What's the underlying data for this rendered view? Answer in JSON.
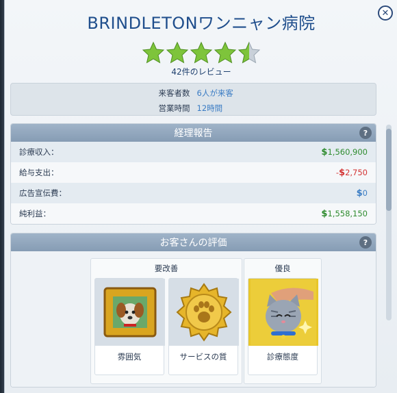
{
  "header": {
    "title": "BRINDLETONワンニャン病院",
    "rating": 4.5,
    "review_count": "42件のレビュー",
    "close_label": "✕"
  },
  "info": {
    "visitors_label": "来客者数",
    "visitors_value": "6人が来客",
    "hours_label": "営業時間",
    "hours_value": "12時間"
  },
  "finance": {
    "title": "経理報告",
    "help": "?",
    "rows": [
      {
        "label": "診療収入：",
        "sign": "",
        "amount": "1,560,900",
        "type": "pos"
      },
      {
        "label": "給与支出：",
        "sign": "-",
        "amount": "2,750",
        "type": "neg"
      },
      {
        "label": "広告宣伝費：",
        "sign": "",
        "amount": "0",
        "type": "zero"
      },
      {
        "label": "純利益：",
        "sign": "",
        "amount": "1,558,150",
        "type": "pos"
      }
    ],
    "currency_symbol": "$"
  },
  "evaluation": {
    "title": "お客さんの評価",
    "help": "?",
    "needs_improvement": {
      "title": "要改善",
      "items": [
        {
          "label": "雰囲気",
          "icon": "dog-portrait-icon"
        },
        {
          "label": "サービスの質",
          "icon": "gold-paw-medal-icon"
        }
      ]
    },
    "excellent": {
      "title": "優良",
      "items": [
        {
          "label": "診療態度",
          "icon": "petting-cat-icon"
        }
      ]
    }
  },
  "colors": {
    "title": "#1f4e8c",
    "positive": "#2e8b2e",
    "negative": "#d33333",
    "neutral": "#3a7cc4",
    "star": "#7ec43b"
  }
}
